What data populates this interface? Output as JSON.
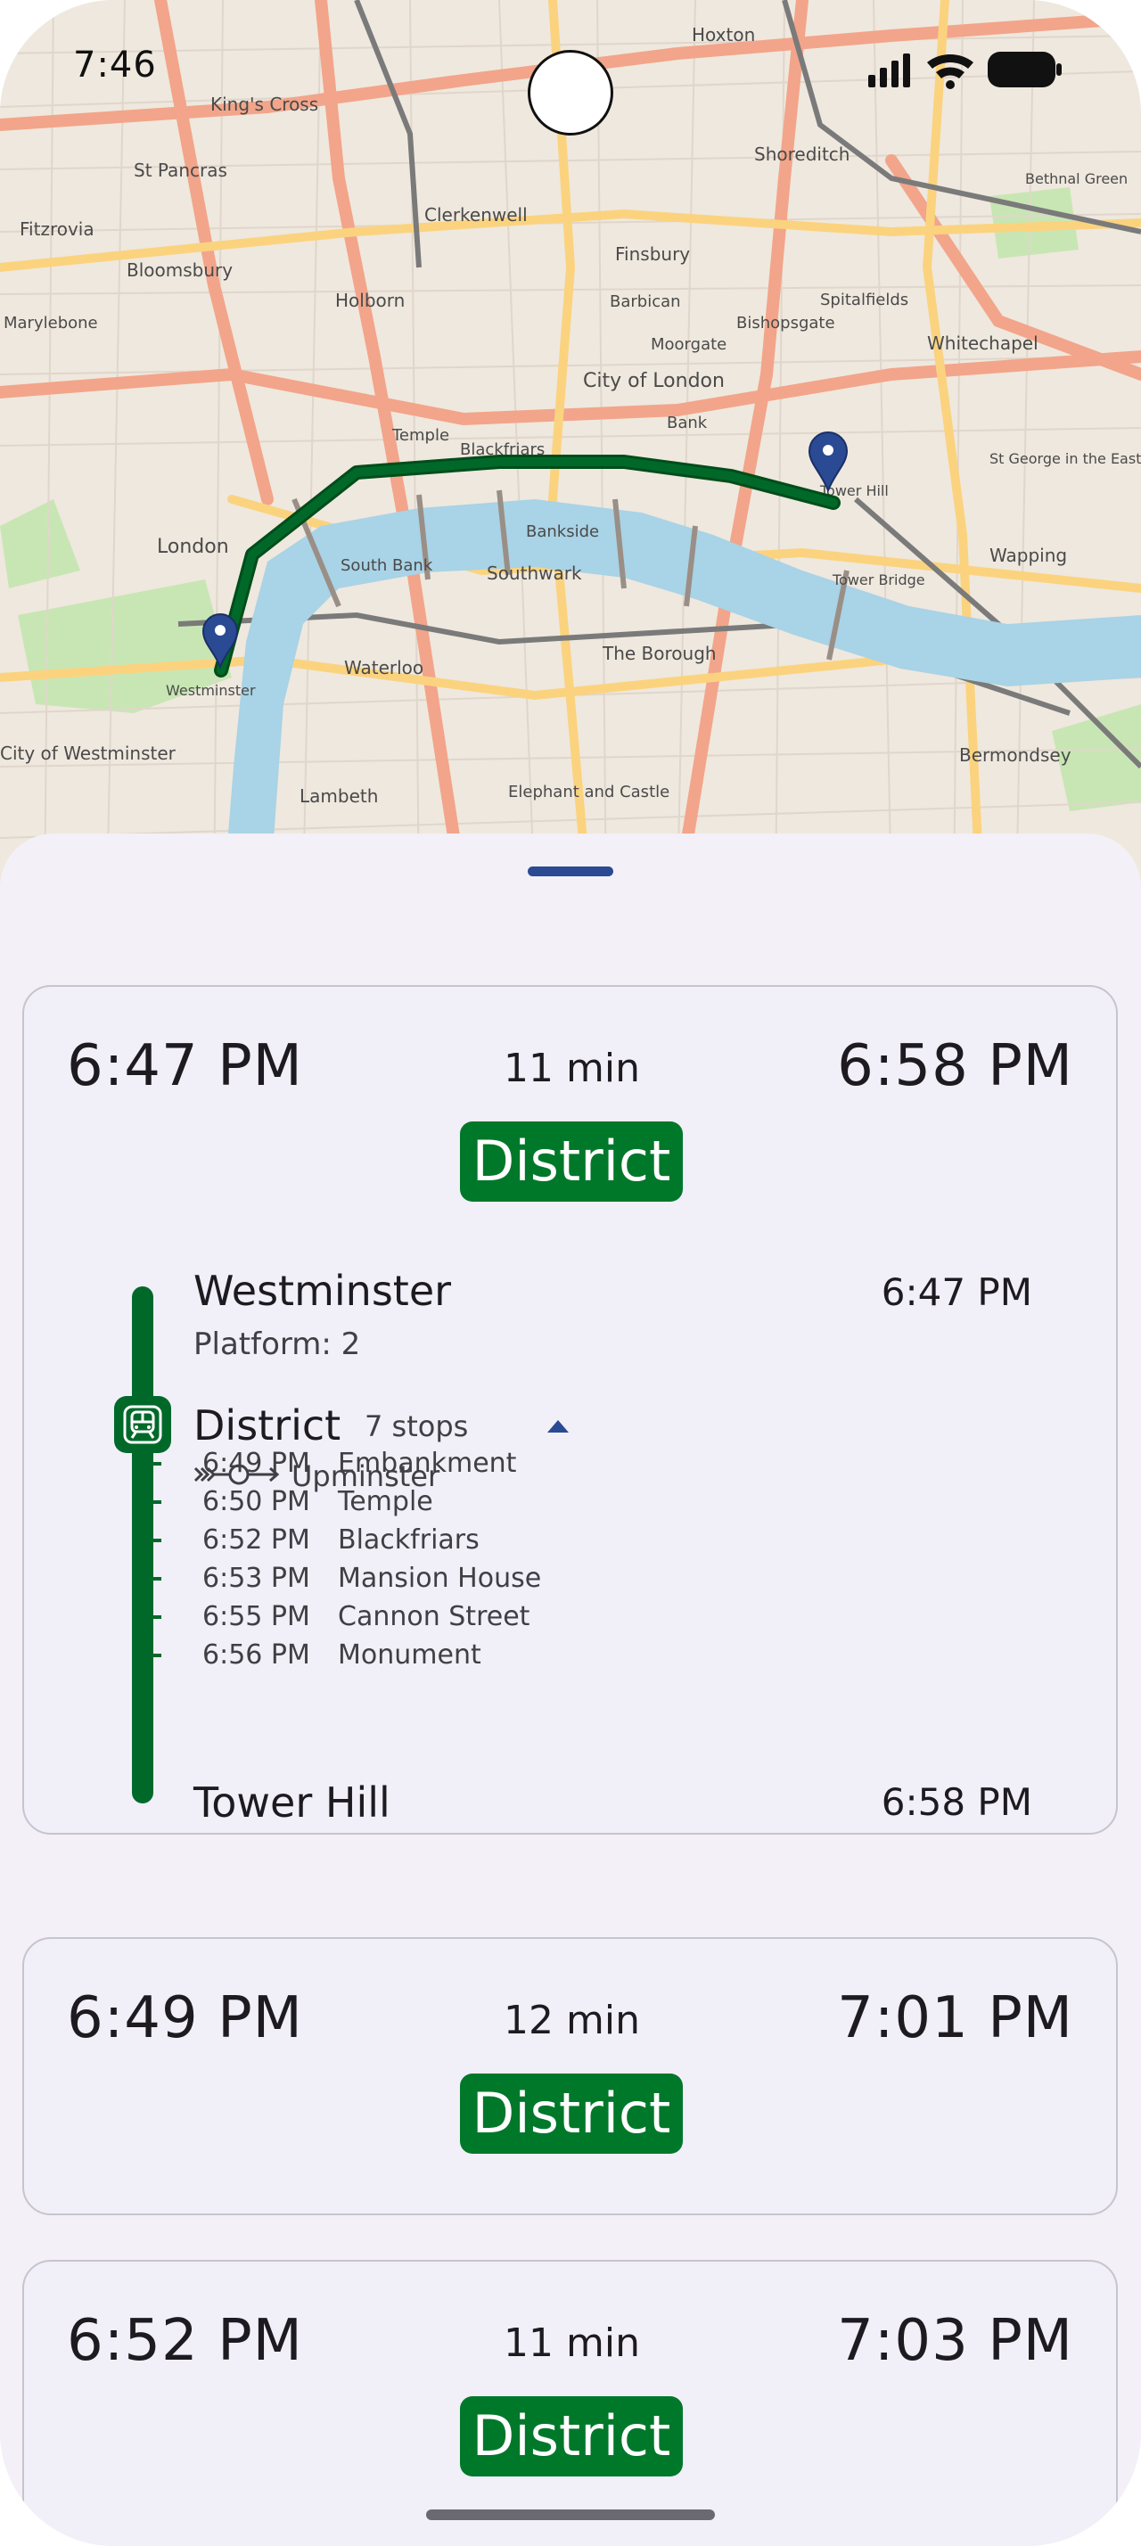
{
  "status_bar": {
    "time": "7:46"
  },
  "map": {
    "labels": [
      {
        "text": "King's Cross"
      },
      {
        "text": "St Pancras"
      },
      {
        "text": "Fitzrovia"
      },
      {
        "text": "Bloomsbury"
      },
      {
        "text": "Marylebone"
      },
      {
        "text": "Clerkenwell"
      },
      {
        "text": "Holborn"
      },
      {
        "text": "Finsbury"
      },
      {
        "text": "Barbican"
      },
      {
        "text": "Shoreditch"
      },
      {
        "text": "Hoxton"
      },
      {
        "text": "Spitalfields"
      },
      {
        "text": "Whitechapel"
      },
      {
        "text": "City of London"
      },
      {
        "text": "Moorgate"
      },
      {
        "text": "Bishopsgate"
      },
      {
        "text": "Temple"
      },
      {
        "text": "Blackfriars"
      },
      {
        "text": "Bank"
      },
      {
        "text": "Bankside"
      },
      {
        "text": "Southwark"
      },
      {
        "text": "South Bank"
      },
      {
        "text": "Waterloo"
      },
      {
        "text": "Lambeth"
      },
      {
        "text": "The Borough"
      },
      {
        "text": "London"
      },
      {
        "text": "Westminster"
      },
      {
        "text": "City of Westminster"
      },
      {
        "text": "Wapping"
      },
      {
        "text": "Tower Bridge"
      },
      {
        "text": "Bermondsey"
      },
      {
        "text": "Elephant and Castle"
      },
      {
        "text": "St George in the East"
      },
      {
        "text": "Tower Hill"
      },
      {
        "text": "Bethnal Green"
      }
    ]
  },
  "journeys": [
    {
      "depart": "6:47 PM",
      "duration": "11 min",
      "arrive": "6:58 PM",
      "line": "District",
      "detail": {
        "origin": {
          "name": "Westminster",
          "time": "6:47 PM",
          "platform": "Platform: 2"
        },
        "leg": {
          "line": "District",
          "stops_count": "7 stops",
          "direction": "Upminster"
        },
        "intermediate": [
          {
            "time": "6:49 PM",
            "name": "Embankment"
          },
          {
            "time": "6:50 PM",
            "name": "Temple"
          },
          {
            "time": "6:52 PM",
            "name": "Blackfriars"
          },
          {
            "time": "6:53 PM",
            "name": "Mansion House"
          },
          {
            "time": "6:55 PM",
            "name": "Cannon Street"
          },
          {
            "time": "6:56 PM",
            "name": "Monument"
          }
        ],
        "destination": {
          "name": "Tower Hill",
          "time": "6:58 PM"
        }
      }
    },
    {
      "depart": "6:49 PM",
      "duration": "12 min",
      "arrive": "7:01 PM",
      "line": "District"
    },
    {
      "depart": "6:52 PM",
      "duration": "11 min",
      "arrive": "7:03 PM",
      "line": "District"
    }
  ],
  "colors": {
    "district_line": "#00782a",
    "map_route": "#00692a",
    "pin": "#2a4a93",
    "river": "#a9d3e6"
  }
}
